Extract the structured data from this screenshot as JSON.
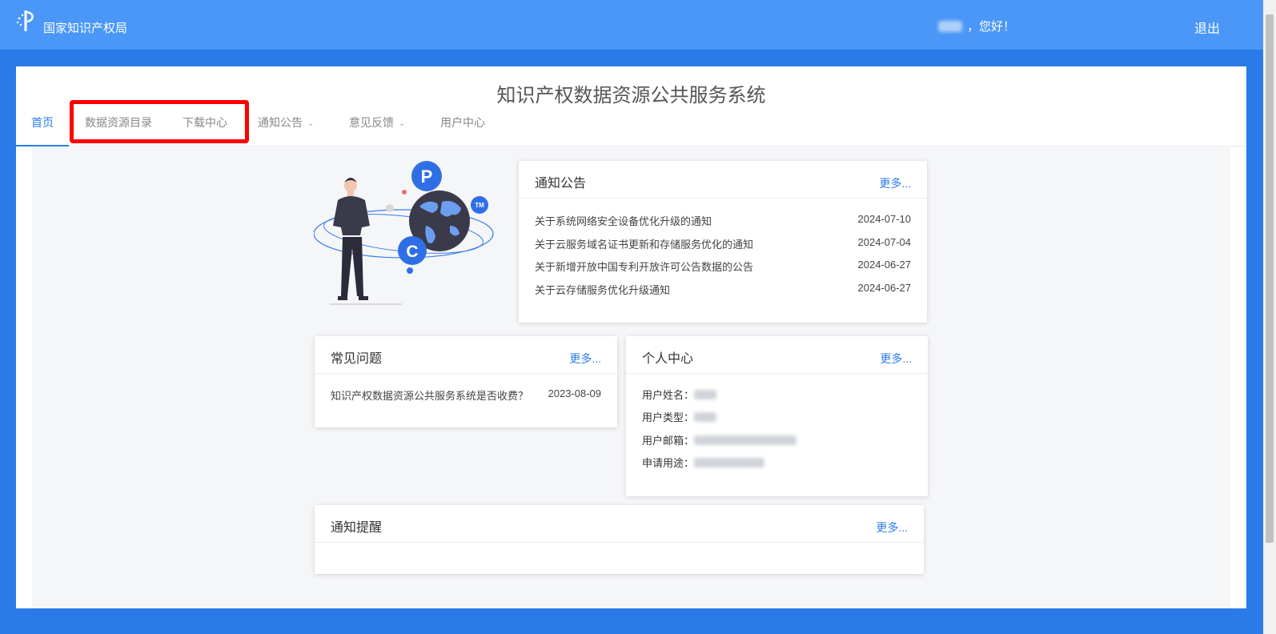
{
  "header": {
    "org_name": "国家知识产权局",
    "greeting": "，您好！",
    "logout": "退出"
  },
  "system_title": "知识产权数据资源公共服务系统",
  "nav": {
    "home": "首页",
    "catalog": "数据资源目录",
    "download": "下载中心",
    "notices": "通知公告",
    "feedback": "意见反馈",
    "user_center": "用户中心"
  },
  "notice_card": {
    "title": "通知公告",
    "more": "更多...",
    "items": [
      {
        "title": "关于系统网络安全设备优化升级的通知",
        "date": "2024-07-10"
      },
      {
        "title": "关于云服务域名证书更新和存储服务优化的通知",
        "date": "2024-07-04"
      },
      {
        "title": "关于新增开放中国专利开放许可公告数据的公告",
        "date": "2024-06-27"
      },
      {
        "title": "关于云存储服务优化升级通知",
        "date": "2024-06-27"
      }
    ]
  },
  "faq_card": {
    "title": "常见问题",
    "more": "更多...",
    "items": [
      {
        "title": "知识产权数据资源公共服务系统是否收费？",
        "date": "2023-08-09"
      }
    ]
  },
  "personal_card": {
    "title": "个人中心",
    "more": "更多...",
    "fields": [
      {
        "label": "用户姓名："
      },
      {
        "label": "用户类型："
      },
      {
        "label": "用户邮箱："
      },
      {
        "label": "申请用途："
      }
    ]
  },
  "reminder_card": {
    "title": "通知提醒",
    "more": "更多..."
  },
  "illustration": {
    "badge_p": "P",
    "badge_c": "C",
    "badge_tm": "TM"
  },
  "colors": {
    "header_bg": "#4a97f7",
    "page_bg": "#2a7be8",
    "accent": "#2a7be8",
    "highlight": "#ff0000"
  }
}
